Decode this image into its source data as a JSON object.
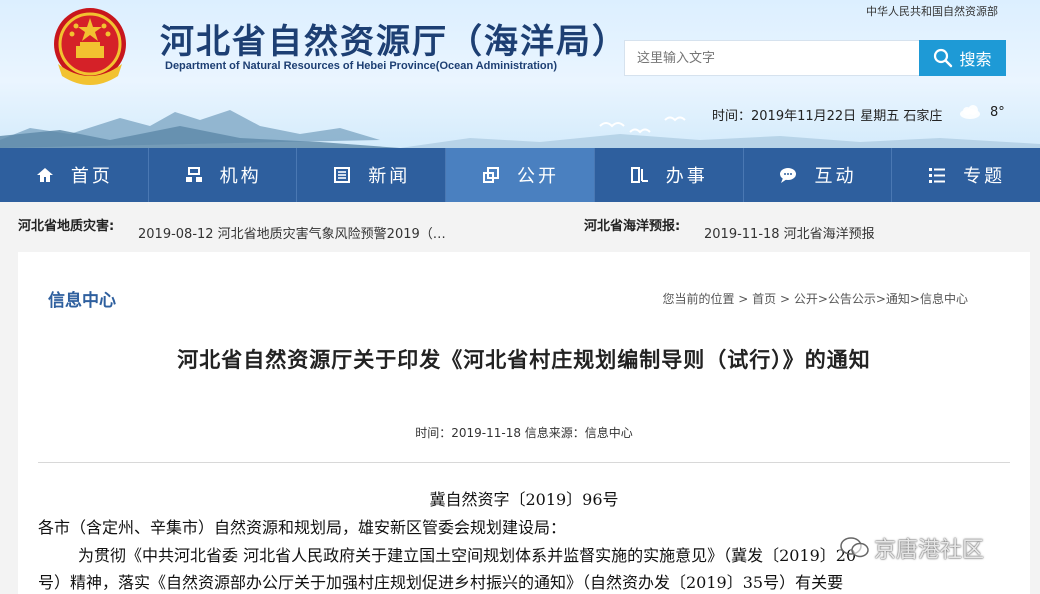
{
  "header": {
    "title_cn": "河北省自然资源厅（海洋局）",
    "title_en": "Department of Natural Resources of Hebei Province(Ocean  Administration)",
    "ministry_link": "中华人民共和国自然资源部",
    "search": {
      "placeholder": "这里输入文字",
      "button_label": "搜索"
    },
    "datetime": "时间：2019年11月22日 星期五 石家庄",
    "temperature": "8°"
  },
  "nav": {
    "items": [
      {
        "label": "首页",
        "icon": "home-icon"
      },
      {
        "label": "机构",
        "icon": "org-icon"
      },
      {
        "label": "新闻",
        "icon": "news-icon"
      },
      {
        "label": "公开",
        "icon": "open-icon",
        "active": true
      },
      {
        "label": "办事",
        "icon": "service-icon"
      },
      {
        "label": "互动",
        "icon": "chat-icon"
      },
      {
        "label": "专题",
        "icon": "list-icon"
      }
    ]
  },
  "ticker": {
    "left_label": "河北省地质灾害:",
    "left_text": "2019-08-12   河北省地质灾害气象风险预警2019（…",
    "right_label": "河北省海洋预报:",
    "right_text": "2019-11-18   河北省海洋预报"
  },
  "content": {
    "section_title": "信息中心",
    "breadcrumb": "您当前的位置 > 首页 > 公开>公告公示>通知>信息中心",
    "article_title": "河北省自然资源厅关于印发《河北省村庄规划编制导则（试行）》的通知",
    "meta": "时间：2019-11-18 信息来源：信息中心",
    "doc_number": "冀自然资字〔2019〕96号",
    "addressee": "各市（含定州、辛集市）自然资源和规划局，雄安新区管委会规划建设局：",
    "para_line1": "为贯彻《中共河北省委 河北省人民政府关于建立国土空间规划体系并监督实施的实施意见》（冀发〔2019〕20",
    "para_line2": "号）精神，落实《自然资源部办公厅关于加强村庄规划促进乡村振兴的通知》（自然资办发〔2019〕35号）有关要"
  },
  "watermark": {
    "text": "京唐港社区"
  },
  "colors": {
    "nav_bg": "#2e5f9e",
    "nav_active": "#4a80c0",
    "search_btn": "#1e9ad6",
    "title_blue": "#1d3f73"
  }
}
